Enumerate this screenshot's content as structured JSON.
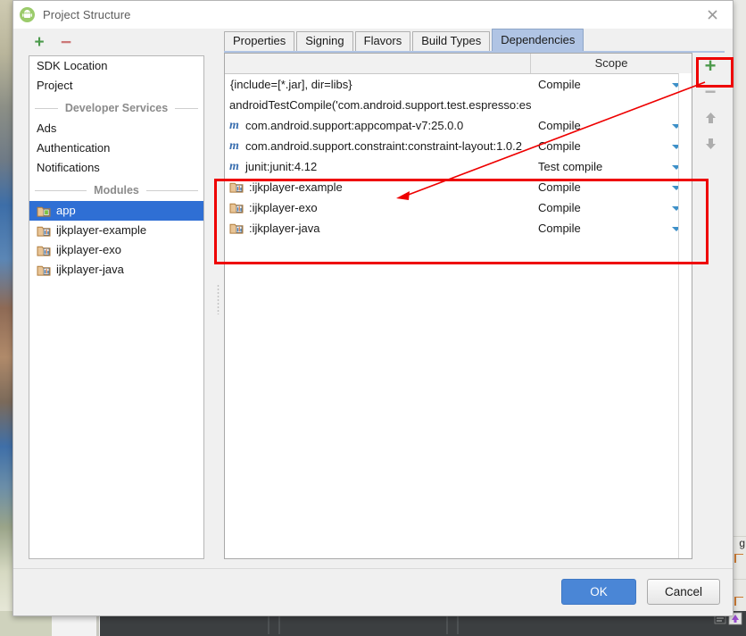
{
  "window": {
    "title": "Project Structure",
    "app_icon": "android-robot-icon",
    "close_label": "×"
  },
  "left_panel": {
    "toolbar": {
      "add_label": "+",
      "remove_label": "−"
    },
    "items": [
      {
        "type": "item",
        "label": "SDK Location",
        "icon": "",
        "selected": false
      },
      {
        "type": "item",
        "label": "Project",
        "icon": "",
        "selected": false
      },
      {
        "type": "separator",
        "label": "Developer Services"
      },
      {
        "type": "item",
        "label": "Ads",
        "icon": "",
        "selected": false
      },
      {
        "type": "item",
        "label": "Authentication",
        "icon": "",
        "selected": false
      },
      {
        "type": "item",
        "label": "Notifications",
        "icon": "",
        "selected": false
      },
      {
        "type": "separator",
        "label": "Modules"
      },
      {
        "type": "item",
        "label": "app",
        "icon": "android-module-icon",
        "selected": true
      },
      {
        "type": "item",
        "label": "ijkplayer-example",
        "icon": "library-module-icon",
        "selected": false
      },
      {
        "type": "item",
        "label": "ijkplayer-exo",
        "icon": "library-module-icon",
        "selected": false
      },
      {
        "type": "item",
        "label": "ijkplayer-java",
        "icon": "library-module-icon",
        "selected": false
      }
    ]
  },
  "right_panel": {
    "tabs": [
      {
        "label": "Properties",
        "active": false
      },
      {
        "label": "Signing",
        "active": false
      },
      {
        "label": "Flavors",
        "active": false
      },
      {
        "label": "Build Types",
        "active": false
      },
      {
        "label": "Dependencies",
        "active": true
      }
    ],
    "table": {
      "columns": [
        "",
        "Scope"
      ],
      "rows": [
        {
          "icon": "",
          "name": "{include=[*.jar], dir=libs}",
          "scope": "Compile",
          "has_dropdown": true
        },
        {
          "icon": "",
          "name": "androidTestCompile('com.android.support.test.espresso:espresso-core:",
          "scope": "",
          "has_dropdown": false
        },
        {
          "icon": "maven-icon",
          "name": "com.android.support:appcompat-v7:25.0.0",
          "scope": "Compile",
          "has_dropdown": true
        },
        {
          "icon": "maven-icon",
          "name": "com.android.support.constraint:constraint-layout:1.0.2",
          "scope": "Compile",
          "has_dropdown": true
        },
        {
          "icon": "maven-icon",
          "name": "junit:junit:4.12",
          "scope": "Test compile",
          "has_dropdown": true
        },
        {
          "icon": "library-module-icon",
          "name": ":ijkplayer-example",
          "scope": "Compile",
          "has_dropdown": true
        },
        {
          "icon": "library-module-icon",
          "name": ":ijkplayer-exo",
          "scope": "Compile",
          "has_dropdown": true
        },
        {
          "icon": "library-module-icon",
          "name": ":ijkplayer-java",
          "scope": "Compile",
          "has_dropdown": true
        }
      ]
    },
    "side_toolbar": {
      "add_label": "+",
      "remove_label": "−",
      "move_up_label": "move-up",
      "move_down_label": "move-down"
    }
  },
  "footer": {
    "ok_label": "OK",
    "cancel_label": "Cancel"
  },
  "annotations": {
    "highlight_color": "#ee0000",
    "boxes": [
      "module-dependency-rows",
      "add-dependency-button"
    ],
    "arrow": "points-from-add-button-to-module-rows"
  },
  "background": {
    "right_edge_glyph": "g"
  },
  "colors": {
    "accent_blue": "#2f6fd4",
    "ok_button": "#4a86d6",
    "tab_active": "#b0c4e4",
    "add_green": "#4c9a4c",
    "annotation_red": "#ee0000"
  }
}
